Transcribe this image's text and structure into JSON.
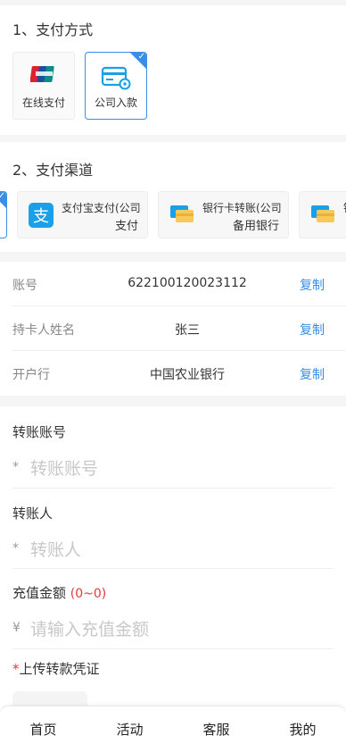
{
  "section1": {
    "title": "1、支付方式",
    "methods": [
      {
        "label": "在线支付",
        "icon": "unionpay-icon",
        "selected": false
      },
      {
        "label": "公司入款",
        "icon": "card-settings-icon",
        "selected": true
      }
    ]
  },
  "section2": {
    "title": "2、支付渠道",
    "channels": [
      {
        "line1": "支付宝支付(公司",
        "line2": "支付",
        "icon": "alipay-icon"
      },
      {
        "line1": "银行卡转账(公司",
        "line2": "备用银行",
        "icon": "bank-card-icon"
      },
      {
        "line1": "银",
        "line2": "",
        "icon": "bank-card-icon"
      }
    ]
  },
  "account_info": {
    "copy_label": "复制",
    "rows": [
      {
        "key": "账号",
        "value": "622100120023112"
      },
      {
        "key": "持卡人姓名",
        "value": "张三"
      },
      {
        "key": "开户行",
        "value": "中国农业银行"
      }
    ]
  },
  "form": {
    "transfer_account": {
      "label": "转账账号",
      "prefix": "*",
      "placeholder": "转账账号"
    },
    "transfer_person": {
      "label": "转账人",
      "prefix": "*",
      "placeholder": "转账人"
    },
    "amount": {
      "label": "充值金额",
      "range": "(0~0)",
      "prefix": "¥",
      "placeholder": "请输入充值金额"
    },
    "upload": {
      "required_mark": "*",
      "label": "上传转款凭证"
    }
  },
  "tabbar": {
    "items": [
      "首页",
      "活动",
      "客服",
      "我的"
    ]
  },
  "colors": {
    "accent": "#3a8ee6",
    "required": "#e53935",
    "placeholder": "#c8c8c8"
  }
}
